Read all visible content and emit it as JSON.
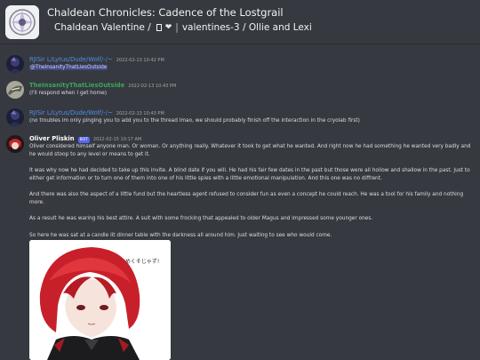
{
  "header": {
    "title": "Chaldean Chronicles: Cadence of the Lostgrail",
    "path_a": "Chaldean Valentine /",
    "path_b": "valentines-3 / Ollie and Lexi"
  },
  "messages": [
    {
      "author": "RJISir L/Lytus/Dude/Wolf/-/~",
      "timestamp": "2022-02-13 10:42 PM",
      "mention": "@TheInsanityThatLiesOutside",
      "author_color": "#4f8ee8"
    },
    {
      "author": "TheInsanityThatLiesOutside",
      "timestamp": "2022-02-13 10:43 PM",
      "text": "(I'll respond when I get home)",
      "author_color": "#3ba55c"
    },
    {
      "author": "RJISir L/Lytus/Dude/Wolf/-/~",
      "timestamp": "2022-02-13 10:43 PM",
      "text": "(no troubles im only pinging you to add you to the thread lmao, we should probably finish off the interaction in the cryolab first)",
      "author_color": "#4f8ee8"
    },
    {
      "author": "Oliver Pliskin",
      "bot_tag": "BOT",
      "timestamp": "2022-02-15 10:17 AM",
      "author_color": "#ffffff",
      "paragraphs": [
        "Oliver considered himself anyone man. Or woman. Or anything really. Whatever it took to get what he wanted. And right now he had something he wanted very badly and he would stoop to any level or means to get it.",
        "It was why now he had decided to take up this invite. A blind date if you will. He had his fair few dates in the past but those were all hollow and shallow in the past. Just to either get information or to turn one of them into one of his little spies with a little emotional manipulation. And this one was no diffrent.",
        "And there was also the aspect of a little fund but the heartless agent refused to consider fun as even a concept he could reach. He was a tool for his family and nothing more.",
        "As a result he was waring his best attire. A suit with some frocking that appealed to older Magus and impressed some younger ones.",
        "So here he was sat at a candle lit dinner table with the darkness all around him. Just waiting to see who would come."
      ],
      "image_caption": "まいた めくそじゃず!"
    }
  ]
}
